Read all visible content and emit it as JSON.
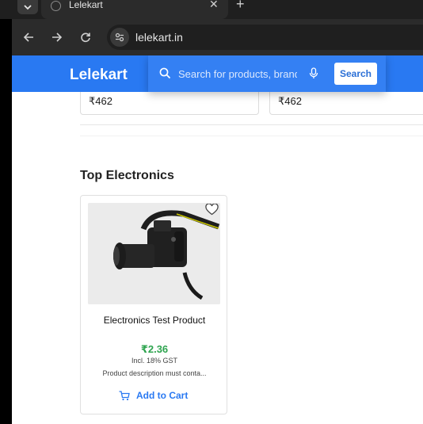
{
  "browser": {
    "tab_title": "Lelekart",
    "url": "lelekart.in"
  },
  "header": {
    "logo": "Lelekart",
    "search_placeholder": "Search for products, brand",
    "search_button": "Search"
  },
  "above_prices": [
    "₹462",
    "₹462"
  ],
  "section": {
    "title": "Top Electronics",
    "product": {
      "name": "Electronics Test Product",
      "price": "₹2.36",
      "tax_note": "Incl. 18% GST",
      "description": "Product description must conta...",
      "cta": "Add to Cart"
    }
  },
  "colors": {
    "brand_blue": "#2979f2",
    "price_green": "#2ea44f"
  }
}
